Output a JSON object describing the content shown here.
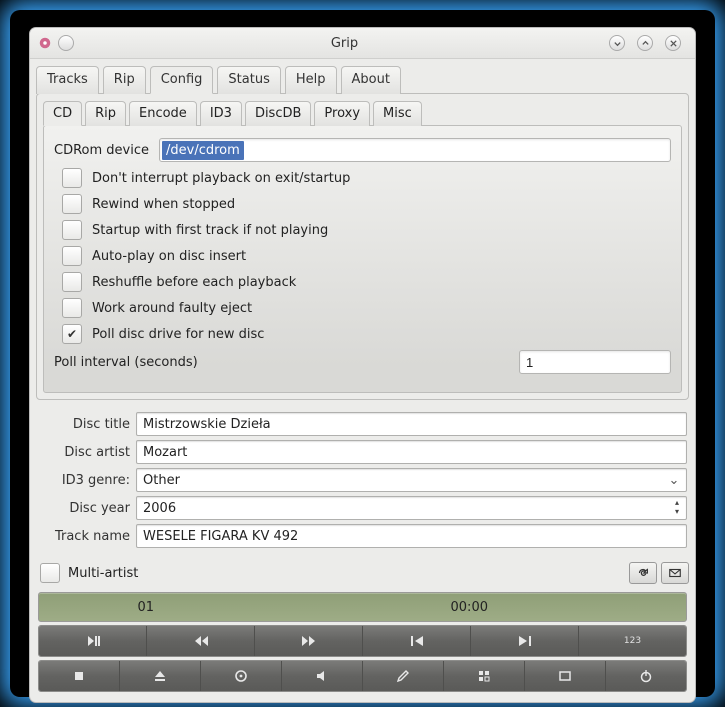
{
  "window": {
    "title": "Grip"
  },
  "main_tabs": [
    "Tracks",
    "Rip",
    "Config",
    "Status",
    "Help",
    "About"
  ],
  "main_tab_active": 2,
  "sub_tabs": [
    "CD",
    "Rip",
    "Encode",
    "ID3",
    "DiscDB",
    "Proxy",
    "Misc"
  ],
  "sub_tab_active": 0,
  "cd": {
    "device_label": "CDRom device",
    "device_value": "/dev/cdrom",
    "checks": [
      {
        "label": "Don't interrupt playback on exit/startup",
        "checked": false
      },
      {
        "label": "Rewind when stopped",
        "checked": false
      },
      {
        "label": "Startup with first track if not playing",
        "checked": false
      },
      {
        "label": "Auto-play on disc insert",
        "checked": false
      },
      {
        "label": "Reshuffle before each playback",
        "checked": false
      },
      {
        "label": "Work around faulty eject",
        "checked": false
      },
      {
        "label": "Poll disc drive for new disc",
        "checked": true
      }
    ],
    "poll_label": "Poll interval (seconds)",
    "poll_value": "1"
  },
  "disc": {
    "title_label": "Disc title",
    "title_value": "Mistrzowskie Dzieła",
    "artist_label": "Disc artist",
    "artist_value": "Mozart",
    "genre_label": "ID3 genre:",
    "genre_value": "Other",
    "year_label": "Disc year",
    "year_value": "2006",
    "track_label": "Track name",
    "track_value": "WESELE FIGARA KV 492",
    "multi_label": "Multi-artist"
  },
  "progress": {
    "track": "01",
    "time": "00:00"
  },
  "icons": {
    "play_pause": "play-pause-icon",
    "rewind": "rewind-icon",
    "fast_forward": "fast-forward-icon",
    "prev_track": "prev-track-icon",
    "next_track": "next-track-icon",
    "counter": "123",
    "stop": "stop-icon",
    "eject": "eject-icon",
    "disc": "disc-icon",
    "volume": "volume-icon",
    "edit": "edit-icon",
    "tracks": "tracks-icon",
    "window": "window-icon",
    "power": "power-icon",
    "refresh": "refresh-icon",
    "mail": "mail-icon"
  }
}
